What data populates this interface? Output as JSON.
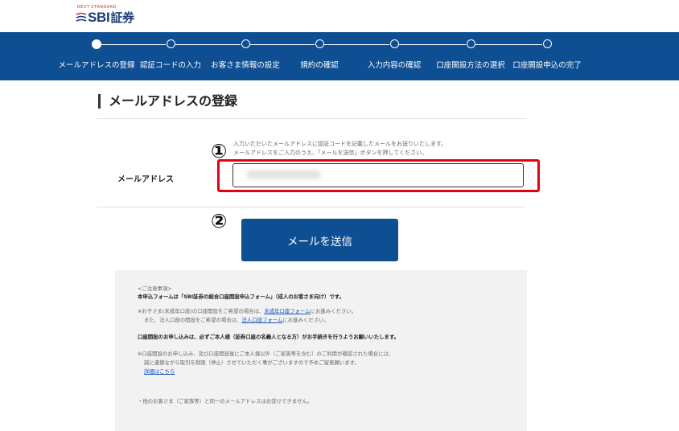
{
  "logo": {
    "tagline": "NEXT STANDARD",
    "name": "SBI",
    "name_jp": "証券"
  },
  "steps": [
    {
      "label": "メールアドレスの登録",
      "active": true
    },
    {
      "label": "認証コードの入力",
      "active": false
    },
    {
      "label": "お客さま情報の設定",
      "active": false
    },
    {
      "label": "規約の確認",
      "active": false
    },
    {
      "label": "入力内容の確認",
      "active": false
    },
    {
      "label": "口座開設方法の選択",
      "active": false
    },
    {
      "label": "口座開設申込の完了",
      "active": false
    }
  ],
  "page_title": "メールアドレスの登録",
  "form": {
    "note_line1": "入力いただいたメールアドレスに認証コードを記載したメールをお送りいたします。",
    "note_line2": "メールアドレスをご入力のうえ、「メールを送信」ボタンを押してください。",
    "email_label": "メールアドレス",
    "email_value": "",
    "marker1": "①",
    "marker2": "②",
    "send_button": "メールを送信"
  },
  "notes": {
    "heading": "<ご注意事項>",
    "bold1": "本申込フォームは「SBI証券の総合口座開設申込フォーム」（成人のお客さま向け）です。",
    "minor_pre": "※お子さま(未成年口座)の口座開設をご希望の場合は、",
    "minor_link": "未成年口座フォーム",
    "minor_post": "にお進みください。",
    "corp_pre": "また、法人口座の開設をご希望の場合は、",
    "corp_link": "法人口座フォーム",
    "corp_post": "にお進みください。",
    "bold2": "口座開設のお申し込みは、必ずご本人様（証券口座の名義人となる方）がお手続きを行うようお願いいたします。",
    "warn1": "※口座開設のお申し込み、及び口座開設後にご本人様以外（ご家族等を含む）のご利用が確認された場合には、",
    "warn2": "誠に遺憾ながら取引を制限（停止）させていただく事がございますので予めご留意願います。",
    "detail_link": "詳細はこちら",
    "bullet1": "・他のお客さま（ご家族等）と同一のメールアドレスはお受けできません。"
  }
}
